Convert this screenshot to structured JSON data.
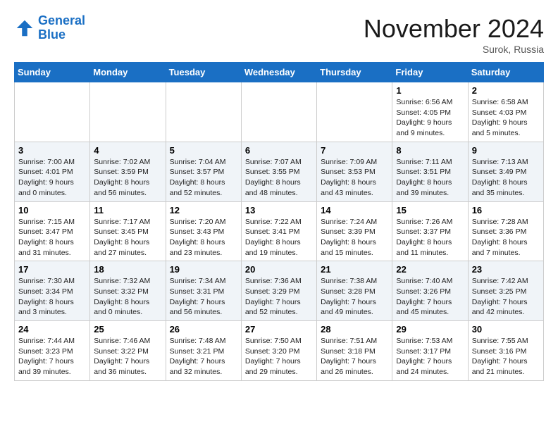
{
  "header": {
    "logo_line1": "General",
    "logo_line2": "Blue",
    "month": "November 2024",
    "location": "Surok, Russia"
  },
  "days_of_week": [
    "Sunday",
    "Monday",
    "Tuesday",
    "Wednesday",
    "Thursday",
    "Friday",
    "Saturday"
  ],
  "weeks": [
    [
      {
        "day": "",
        "info": ""
      },
      {
        "day": "",
        "info": ""
      },
      {
        "day": "",
        "info": ""
      },
      {
        "day": "",
        "info": ""
      },
      {
        "day": "",
        "info": ""
      },
      {
        "day": "1",
        "info": "Sunrise: 6:56 AM\nSunset: 4:05 PM\nDaylight: 9 hours and 9 minutes."
      },
      {
        "day": "2",
        "info": "Sunrise: 6:58 AM\nSunset: 4:03 PM\nDaylight: 9 hours and 5 minutes."
      }
    ],
    [
      {
        "day": "3",
        "info": "Sunrise: 7:00 AM\nSunset: 4:01 PM\nDaylight: 9 hours and 0 minutes."
      },
      {
        "day": "4",
        "info": "Sunrise: 7:02 AM\nSunset: 3:59 PM\nDaylight: 8 hours and 56 minutes."
      },
      {
        "day": "5",
        "info": "Sunrise: 7:04 AM\nSunset: 3:57 PM\nDaylight: 8 hours and 52 minutes."
      },
      {
        "day": "6",
        "info": "Sunrise: 7:07 AM\nSunset: 3:55 PM\nDaylight: 8 hours and 48 minutes."
      },
      {
        "day": "7",
        "info": "Sunrise: 7:09 AM\nSunset: 3:53 PM\nDaylight: 8 hours and 43 minutes."
      },
      {
        "day": "8",
        "info": "Sunrise: 7:11 AM\nSunset: 3:51 PM\nDaylight: 8 hours and 39 minutes."
      },
      {
        "day": "9",
        "info": "Sunrise: 7:13 AM\nSunset: 3:49 PM\nDaylight: 8 hours and 35 minutes."
      }
    ],
    [
      {
        "day": "10",
        "info": "Sunrise: 7:15 AM\nSunset: 3:47 PM\nDaylight: 8 hours and 31 minutes."
      },
      {
        "day": "11",
        "info": "Sunrise: 7:17 AM\nSunset: 3:45 PM\nDaylight: 8 hours and 27 minutes."
      },
      {
        "day": "12",
        "info": "Sunrise: 7:20 AM\nSunset: 3:43 PM\nDaylight: 8 hours and 23 minutes."
      },
      {
        "day": "13",
        "info": "Sunrise: 7:22 AM\nSunset: 3:41 PM\nDaylight: 8 hours and 19 minutes."
      },
      {
        "day": "14",
        "info": "Sunrise: 7:24 AM\nSunset: 3:39 PM\nDaylight: 8 hours and 15 minutes."
      },
      {
        "day": "15",
        "info": "Sunrise: 7:26 AM\nSunset: 3:37 PM\nDaylight: 8 hours and 11 minutes."
      },
      {
        "day": "16",
        "info": "Sunrise: 7:28 AM\nSunset: 3:36 PM\nDaylight: 8 hours and 7 minutes."
      }
    ],
    [
      {
        "day": "17",
        "info": "Sunrise: 7:30 AM\nSunset: 3:34 PM\nDaylight: 8 hours and 3 minutes."
      },
      {
        "day": "18",
        "info": "Sunrise: 7:32 AM\nSunset: 3:32 PM\nDaylight: 8 hours and 0 minutes."
      },
      {
        "day": "19",
        "info": "Sunrise: 7:34 AM\nSunset: 3:31 PM\nDaylight: 7 hours and 56 minutes."
      },
      {
        "day": "20",
        "info": "Sunrise: 7:36 AM\nSunset: 3:29 PM\nDaylight: 7 hours and 52 minutes."
      },
      {
        "day": "21",
        "info": "Sunrise: 7:38 AM\nSunset: 3:28 PM\nDaylight: 7 hours and 49 minutes."
      },
      {
        "day": "22",
        "info": "Sunrise: 7:40 AM\nSunset: 3:26 PM\nDaylight: 7 hours and 45 minutes."
      },
      {
        "day": "23",
        "info": "Sunrise: 7:42 AM\nSunset: 3:25 PM\nDaylight: 7 hours and 42 minutes."
      }
    ],
    [
      {
        "day": "24",
        "info": "Sunrise: 7:44 AM\nSunset: 3:23 PM\nDaylight: 7 hours and 39 minutes."
      },
      {
        "day": "25",
        "info": "Sunrise: 7:46 AM\nSunset: 3:22 PM\nDaylight: 7 hours and 36 minutes."
      },
      {
        "day": "26",
        "info": "Sunrise: 7:48 AM\nSunset: 3:21 PM\nDaylight: 7 hours and 32 minutes."
      },
      {
        "day": "27",
        "info": "Sunrise: 7:50 AM\nSunset: 3:20 PM\nDaylight: 7 hours and 29 minutes."
      },
      {
        "day": "28",
        "info": "Sunrise: 7:51 AM\nSunset: 3:18 PM\nDaylight: 7 hours and 26 minutes."
      },
      {
        "day": "29",
        "info": "Sunrise: 7:53 AM\nSunset: 3:17 PM\nDaylight: 7 hours and 24 minutes."
      },
      {
        "day": "30",
        "info": "Sunrise: 7:55 AM\nSunset: 3:16 PM\nDaylight: 7 hours and 21 minutes."
      }
    ]
  ]
}
